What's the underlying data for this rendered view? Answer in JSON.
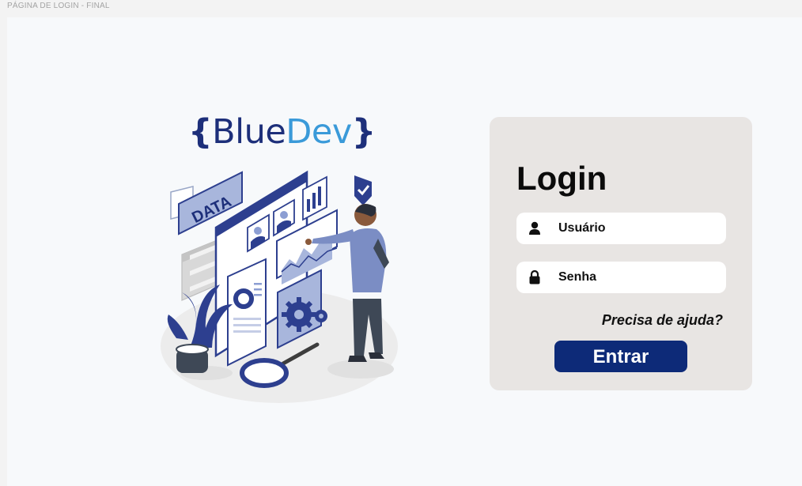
{
  "frame": {
    "title": "PÁGINA DE LOGIN - FINAL"
  },
  "brand": {
    "open_brace": "{",
    "blue": "Blue",
    "dev": "Dev",
    "close_brace": "}"
  },
  "illustration": {
    "sign_text": "DATA"
  },
  "login": {
    "title": "Login",
    "username_label": "Usuário",
    "password_label": "Senha",
    "help_link": "Precisa de ajuda?",
    "submit_label": "Entrar"
  },
  "colors": {
    "primary": "#0d2a78",
    "accent": "#3a9ad9",
    "card_bg": "#e8e5e3",
    "canvas_bg": "#f7f9fb"
  },
  "icons": {
    "username": "user-icon",
    "password": "lock-icon"
  }
}
